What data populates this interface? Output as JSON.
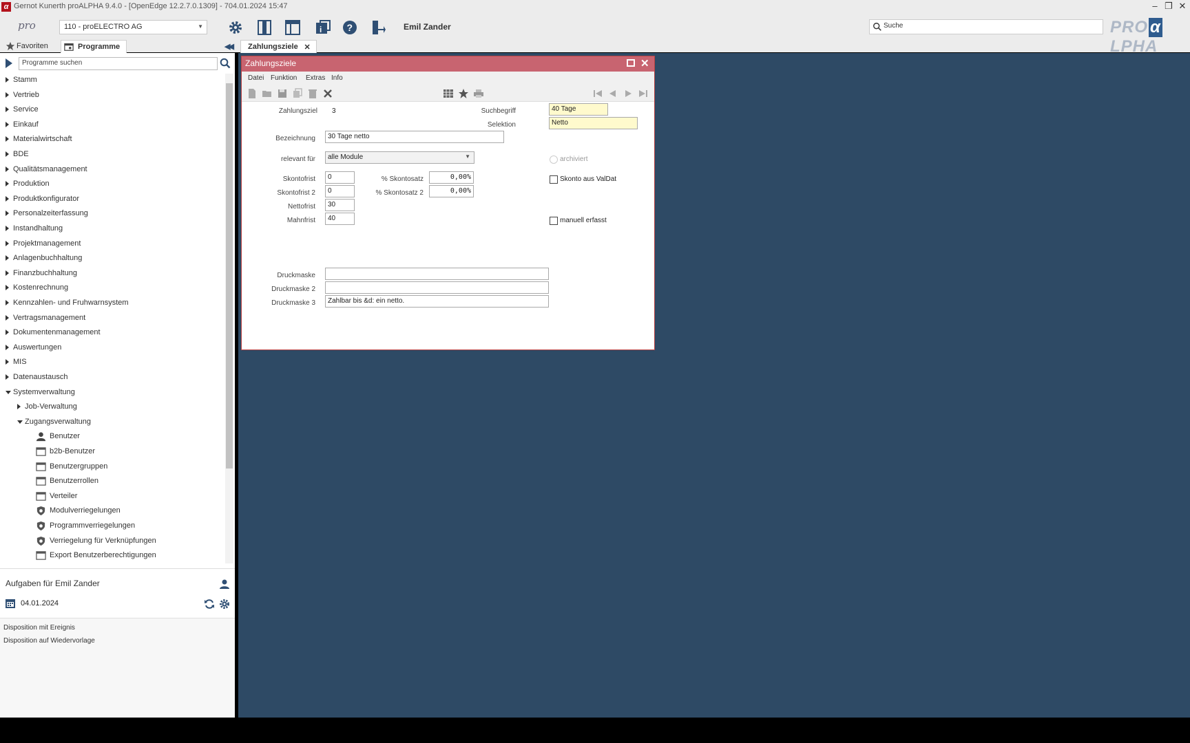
{
  "window": {
    "title": "Gernot Kunerth proALPHA 9.4.0 - [OpenEdge 12.2.7.0.1309] - 704.01.2024 15:47",
    "app_icon_letter": "α"
  },
  "toolbar": {
    "logo": "pro",
    "client": "110 - proELECTRO AG",
    "user": "Emil Zander",
    "search_placeholder": "Suche",
    "brand_pre": "PRO",
    "brand_alpha": "α",
    "brand_post": "LPHA",
    "icons": [
      "gear-icon",
      "layout-split-icon",
      "layout-panel-icon",
      "info-icon",
      "help-icon",
      "logout-icon"
    ]
  },
  "nav_tabs": {
    "favorites": "Favoriten",
    "programs": "Programme"
  },
  "program_search": {
    "placeholder": "Programme suchen"
  },
  "tree": [
    {
      "label": "Stamm",
      "level": 0,
      "expanded": false
    },
    {
      "label": "Vertrieb",
      "level": 0,
      "expanded": false
    },
    {
      "label": "Service",
      "level": 0,
      "expanded": false
    },
    {
      "label": "Einkauf",
      "level": 0,
      "expanded": false
    },
    {
      "label": "Materialwirtschaft",
      "level": 0,
      "expanded": false
    },
    {
      "label": "BDE",
      "level": 0,
      "expanded": false
    },
    {
      "label": "Qualitätsmanagement",
      "level": 0,
      "expanded": false
    },
    {
      "label": "Produktion",
      "level": 0,
      "expanded": false
    },
    {
      "label": "Produktkonfigurator",
      "level": 0,
      "expanded": false
    },
    {
      "label": "Personalzeiterfassung",
      "level": 0,
      "expanded": false
    },
    {
      "label": "Instandhaltung",
      "level": 0,
      "expanded": false
    },
    {
      "label": "Projektmanagement",
      "level": 0,
      "expanded": false
    },
    {
      "label": "Anlagenbuchhaltung",
      "level": 0,
      "expanded": false
    },
    {
      "label": "Finanzbuchhaltung",
      "level": 0,
      "expanded": false
    },
    {
      "label": "Kostenrechnung",
      "level": 0,
      "expanded": false
    },
    {
      "label": "Kennzahlen- und Fruhwarnsystem",
      "level": 0,
      "expanded": false
    },
    {
      "label": "Vertragsmanagement",
      "level": 0,
      "expanded": false
    },
    {
      "label": "Dokumentenmanagement",
      "level": 0,
      "expanded": false
    },
    {
      "label": "Auswertungen",
      "level": 0,
      "expanded": false
    },
    {
      "label": "MIS",
      "level": 0,
      "expanded": false
    },
    {
      "label": "Datenaustausch",
      "level": 0,
      "expanded": false
    },
    {
      "label": "Systemverwaltung",
      "level": 0,
      "expanded": true
    },
    {
      "label": "Job-Verwaltung",
      "level": 1,
      "expanded": false
    },
    {
      "label": "Zugangsverwaltung",
      "level": 1,
      "expanded": true
    },
    {
      "label": "Benutzer",
      "level": 2,
      "icon": "user-icon"
    },
    {
      "label": "b2b-Benutzer",
      "level": 2,
      "icon": "window-icon"
    },
    {
      "label": "Benutzergruppen",
      "level": 2,
      "icon": "window-icon"
    },
    {
      "label": "Benutzerrollen",
      "level": 2,
      "icon": "window-icon"
    },
    {
      "label": "Verteiler",
      "level": 2,
      "icon": "window-icon"
    },
    {
      "label": "Modulverriegelungen",
      "level": 2,
      "icon": "shield-icon"
    },
    {
      "label": "Programmverriegelungen",
      "level": 2,
      "icon": "shield-icon"
    },
    {
      "label": "Verriegelung für Verknüpfungen",
      "level": 2,
      "icon": "shield-icon"
    },
    {
      "label": "Export Benutzerberechtigungen",
      "level": 2,
      "icon": "window-icon"
    }
  ],
  "tasks": {
    "header": "Aufgaben für Emil Zander",
    "date": "04.01.2024",
    "items": [
      "Disposition mit Ereignis",
      "Disposition auf Wiedervorlage"
    ]
  },
  "doc_tab": {
    "label": "Zahlungsziele"
  },
  "dialog": {
    "title": "Zahlungsziele",
    "title_color": "#c86470",
    "menu": [
      "Datei",
      "Funktion",
      "Extras",
      "Info"
    ],
    "form": {
      "zahlungsziel_label": "Zahlungsziel",
      "zahlungsziel_value": "3",
      "suchbegriff_label": "Suchbegriff",
      "suchbegriff_value": "40 Tage",
      "selektion_label": "Selektion",
      "selektion_value": "Netto",
      "bezeichnung_label": "Bezeichnung",
      "bezeichnung_value": "30 Tage netto",
      "relevant_label": "relevant für",
      "relevant_value": "alle Module",
      "archiviert_label": "archiviert",
      "skontofrist_label": "Skontofrist",
      "skontofrist_value": "0",
      "skontofrist2_label": "Skontofrist 2",
      "skontofrist2_value": "0",
      "nettofrist_label": "Nettofrist",
      "nettofrist_value": "30",
      "mahnfrist_label": "Mahnfrist",
      "mahnfrist_value": "40",
      "skontosatz_label": "% Skontosatz",
      "skontosatz_value": "0,00%",
      "skontosatz2_label": "% Skontosatz 2",
      "skontosatz2_value": "0,00%",
      "skonto_valdat_label": "Skonto aus ValDat",
      "manuell_label": "manuell erfasst",
      "druckmaske_label": "Druckmaske",
      "druckmaske_value": "",
      "druckmaske2_label": "Druckmaske 2",
      "druckmaske2_value": "",
      "druckmaske3_label": "Druckmaske 3",
      "druckmaske3_value": "Zahlbar bis &d: ein netto."
    }
  },
  "colors": {
    "main_bg": "#2e4a65",
    "accent": "#2f4f74",
    "yellow_field": "#fffacd"
  }
}
